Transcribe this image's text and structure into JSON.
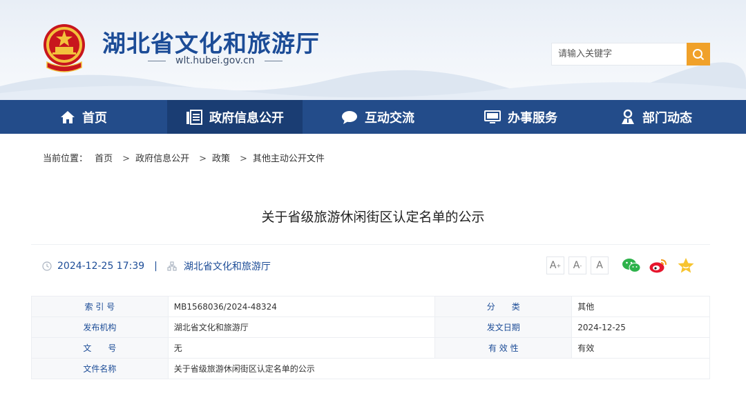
{
  "header": {
    "site_title": "湖北省文化和旅游厅",
    "site_url": "wlt.hubei.gov.cn",
    "search_placeholder": "请输入关键字",
    "search_icon": "search-icon",
    "accent_color": "#f0a12a"
  },
  "nav": {
    "items": [
      {
        "label": "首页",
        "icon": "home-icon"
      },
      {
        "label": "政府信息公开",
        "icon": "document-icon"
      },
      {
        "label": "互动交流",
        "icon": "chat-icon"
      },
      {
        "label": "办事服务",
        "icon": "monitor-icon"
      },
      {
        "label": "部门动态",
        "icon": "person-icon"
      }
    ],
    "active_index": 1,
    "bg_color": "#234c8a"
  },
  "breadcrumb": {
    "prefix": "当前位置：",
    "items": [
      "首页",
      "政府信息公开",
      "政策",
      "其他主动公开文件"
    ],
    "separator": ">"
  },
  "article": {
    "title": "关于省级旅游休闲街区认定名单的公示",
    "datetime": "2024-12-25 17:39",
    "divider": "|",
    "source": "湖北省文化和旅游厅",
    "font_controls": [
      "A",
      "A",
      "A"
    ],
    "share_icons": [
      "wechat-icon",
      "weibo-icon",
      "favorite-icon"
    ]
  },
  "info_table": {
    "rows": [
      {
        "l1": "索 引 号",
        "v1": "MB1568036/2024-48324",
        "l2": "分　　类",
        "v2": "其他"
      },
      {
        "l1": "发布机构",
        "v1": "湖北省文化和旅游厅",
        "l2": "发文日期",
        "v2": "2024-12-25"
      },
      {
        "l1": "文　　号",
        "v1": "无",
        "l2": "有 效 性",
        "v2": "有效"
      },
      {
        "l1": "文件名称",
        "v1": "关于省级旅游休闲街区认定名单的公示",
        "l2": "",
        "v2": ""
      }
    ]
  }
}
